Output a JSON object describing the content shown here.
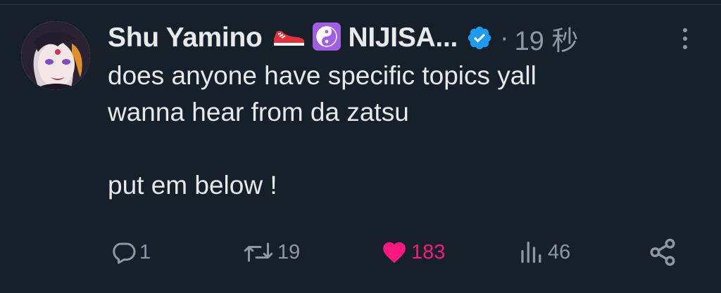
{
  "tweet": {
    "author_name": "Shu Yamino",
    "org_name": "NIJISA...",
    "separator": "·",
    "time": "19 秒",
    "lines": [
      "does anyone have specific topics yall",
      "wanna hear from da zatsu",
      "put em below !"
    ]
  },
  "actions": {
    "reply_count": "1",
    "retweet_count": "19",
    "like_count": "183",
    "views_count": "46"
  },
  "colors": {
    "background": "#15202b",
    "text": "#e7e9ea",
    "muted": "#8b98a5",
    "like": "#f91880",
    "verified": "#1d9bf0"
  },
  "icons": {
    "more": "more-vertical-icon",
    "reply": "reply-icon",
    "retweet": "retweet-icon",
    "like": "heart-icon",
    "views": "views-chart-icon",
    "share": "share-icon",
    "verified": "verified-badge-icon",
    "shoe": "sneaker-emoji-icon",
    "yinyang": "yin-yang-emoji-icon"
  }
}
